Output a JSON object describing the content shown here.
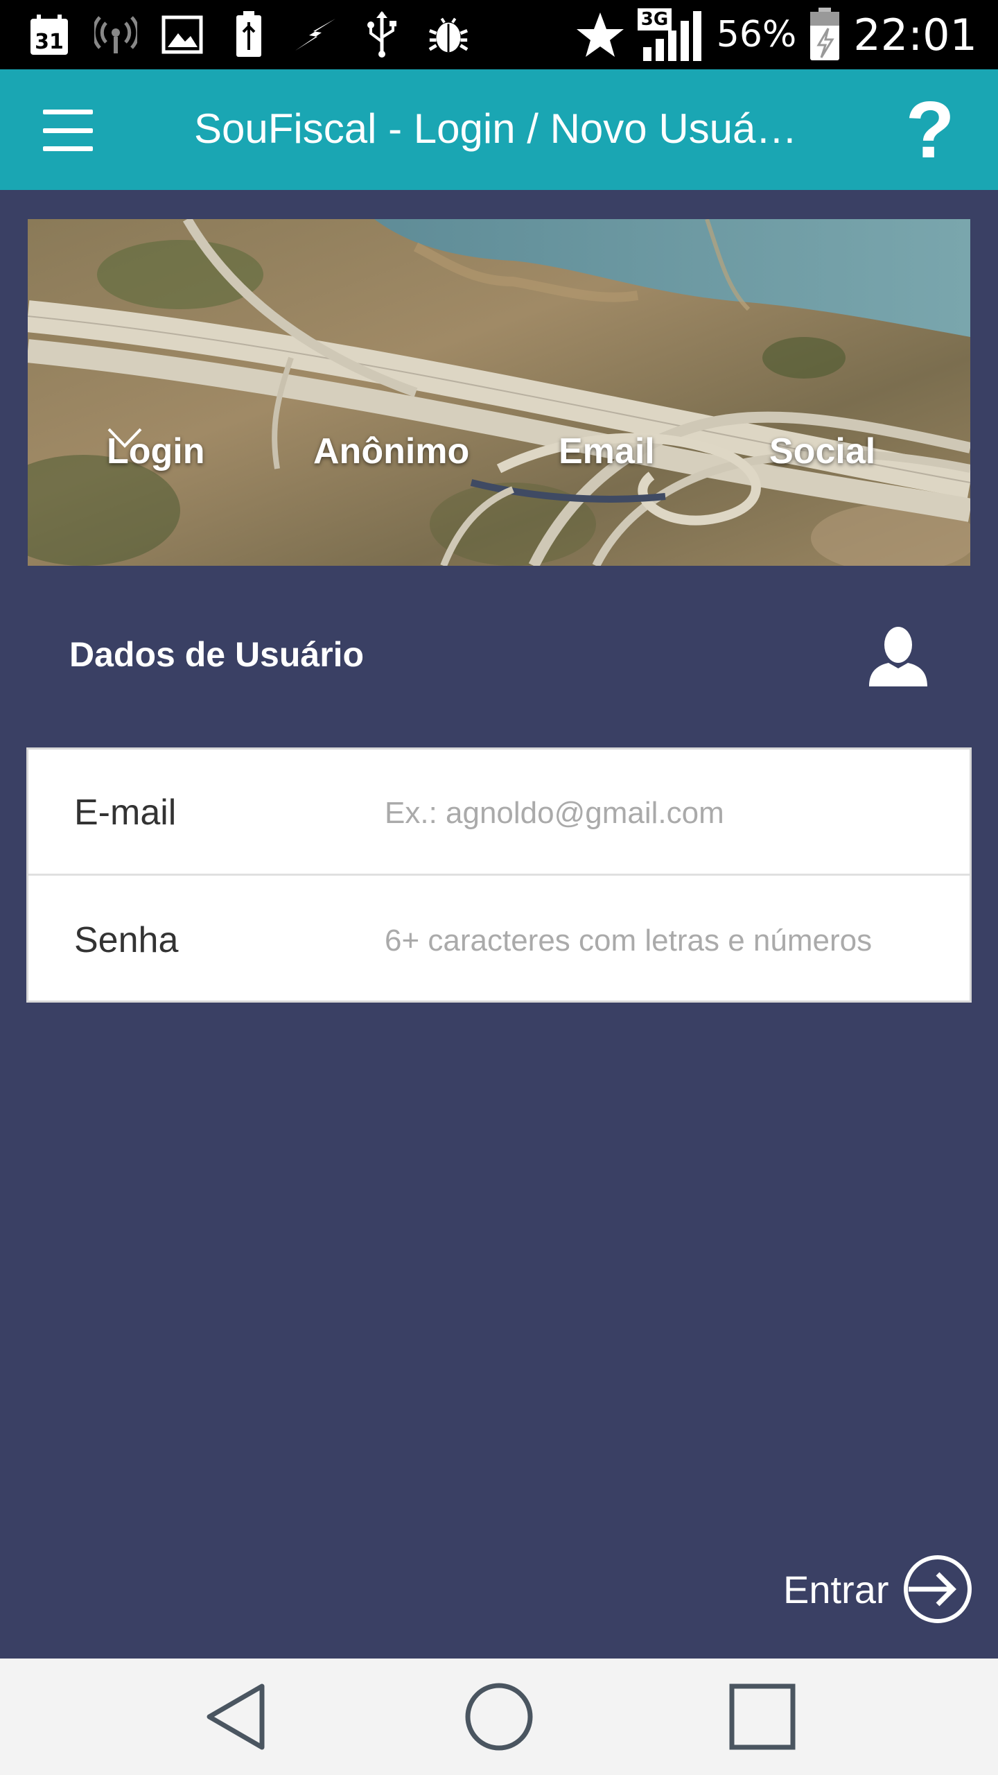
{
  "status_bar": {
    "icons_left": [
      "calendar-icon",
      "wifi-hotspot-icon",
      "image-icon",
      "battery-usb-icon",
      "flash-icon",
      "usb-icon",
      "android-debug-icon"
    ],
    "calendar_day": "31",
    "network": "3G",
    "battery": "56%",
    "time": "22:01"
  },
  "app_bar": {
    "title": "SouFiscal - Login / Novo Usuá…",
    "help_label": "?"
  },
  "hero": {
    "tabs": [
      {
        "label": "Login",
        "has_dropdown": true
      },
      {
        "label": "Anônimo"
      },
      {
        "label": "Email"
      },
      {
        "label": "Social"
      }
    ]
  },
  "section": {
    "title": "Dados de Usuário"
  },
  "form": {
    "email": {
      "label": "E-mail",
      "value": "",
      "placeholder": "Ex.: agnoldo@gmail.com"
    },
    "senha": {
      "label": "Senha",
      "value": "",
      "placeholder": "6+ caracteres com letras e números"
    }
  },
  "actions": {
    "entrar_label": "Entrar"
  },
  "colors": {
    "app_bar": "#1aa6b3",
    "background": "#3a4064",
    "nav_bar": "#f3f3f3"
  }
}
